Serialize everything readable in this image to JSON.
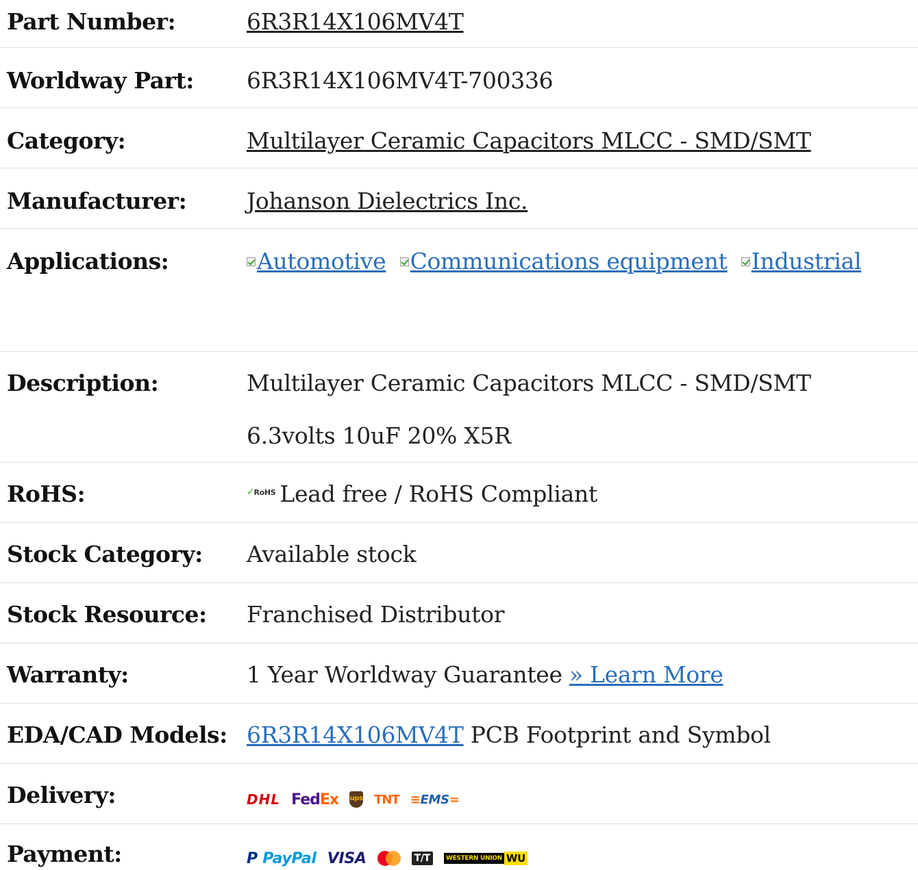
{
  "rows": {
    "part_number": {
      "label": "Part Number:",
      "value": "6R3R14X106MV4T"
    },
    "worldway_part": {
      "label": "Worldway Part:",
      "value": "6R3R14X106MV4T-700336"
    },
    "category": {
      "label": "Category:",
      "value": "Multilayer Ceramic Capacitors MLCC - SMD/SMT"
    },
    "manufacturer": {
      "label": "Manufacturer:",
      "value": "Johanson Dielectrics Inc."
    },
    "applications": {
      "label": "Applications:",
      "items": [
        "Automotive",
        "Communications equipment",
        "Industrial"
      ]
    },
    "description": {
      "label": "Description:",
      "line1": "Multilayer Ceramic Capacitors MLCC - SMD/SMT",
      "line2": "6.3volts 10uF 20% X5R"
    },
    "rohs": {
      "label": "RoHS:",
      "badge": "RoHS",
      "value": "Lead free / RoHS Compliant"
    },
    "stock_category": {
      "label": "Stock Category:",
      "value": "Available stock"
    },
    "stock_resource": {
      "label": "Stock Resource:",
      "value": "Franchised Distributor"
    },
    "warranty": {
      "label": "Warranty:",
      "value": "1 Year Worldway Guarantee",
      "link": "» Learn More"
    },
    "eda_cad": {
      "label": "EDA/CAD Models:",
      "link": "6R3R14X106MV4T",
      "value": "PCB Footprint and Symbol"
    },
    "delivery": {
      "label": "Delivery:",
      "carriers": {
        "dhl": "DHL",
        "fed": "Fed",
        "ex": "Ex",
        "ups": "ups",
        "tnt": "TNT",
        "ems": "EMS"
      }
    },
    "payment": {
      "label": "Payment:",
      "methods": {
        "paypal_p": "P",
        "paypal": "PayPal",
        "visa": "VISA",
        "tt": "T/T",
        "wu_text": "WESTERN UNION",
        "wu": "WU"
      }
    }
  },
  "colors": {
    "link": "#2a6ebb",
    "divider": "#e0e0e0",
    "check": "#3aa335"
  }
}
